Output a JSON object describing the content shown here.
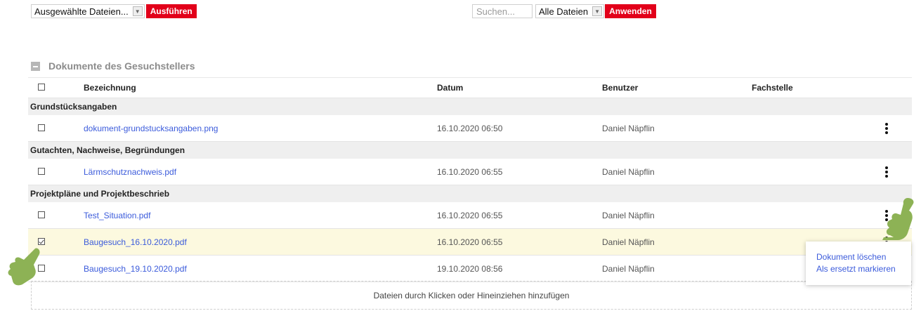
{
  "toolbar": {
    "bulk_select_value": "Ausgewählte Dateien...",
    "execute_label": "Ausführen",
    "search_placeholder": "Suchen...",
    "filter_value": "Alle Dateien",
    "apply_label": "Anwenden"
  },
  "section": {
    "title": "Dokumente des Gesuchstellers"
  },
  "table": {
    "columns": {
      "name": "Bezeichnung",
      "date": "Datum",
      "user": "Benutzer",
      "fach": "Fachstelle"
    },
    "groups": [
      {
        "label": "Grundstücksangaben",
        "rows": [
          {
            "name": "dokument-grundstucksangaben.png",
            "date": "16.10.2020 06:50",
            "user": "Daniel Näpflin",
            "checked": false
          }
        ]
      },
      {
        "label": "Gutachten, Nachweise, Begründungen",
        "rows": [
          {
            "name": "Lärmschutznachweis.pdf",
            "date": "16.10.2020 06:55",
            "user": "Daniel Näpflin",
            "checked": false
          }
        ]
      },
      {
        "label": "Projektpläne und Projektbeschrieb",
        "rows": [
          {
            "name": "Test_Situation.pdf",
            "date": "16.10.2020 06:55",
            "user": "Daniel Näpflin",
            "checked": false
          },
          {
            "name": "Baugesuch_16.10.2020.pdf",
            "date": "16.10.2020 06:55",
            "user": "Daniel Näpflin",
            "checked": true
          },
          {
            "name": "Baugesuch_19.10.2020.pdf",
            "date": "19.10.2020 08:56",
            "user": "Daniel Näpflin",
            "checked": false
          }
        ]
      }
    ]
  },
  "context_menu": {
    "delete_label": "Dokument löschen",
    "replace_label": "Als ersetzt markieren"
  },
  "dropzone": {
    "label": "Dateien durch Klicken oder Hineinziehen hinzufügen"
  },
  "colors": {
    "accent_red": "#e2001a",
    "link_blue": "#3b5bdb",
    "selected_row": "#fcf9df",
    "hand_green": "#8db255"
  },
  "icons": [
    "chevron-down-icon",
    "collapse-icon",
    "kebab-menu-icon",
    "pointing-hand-icon"
  ]
}
